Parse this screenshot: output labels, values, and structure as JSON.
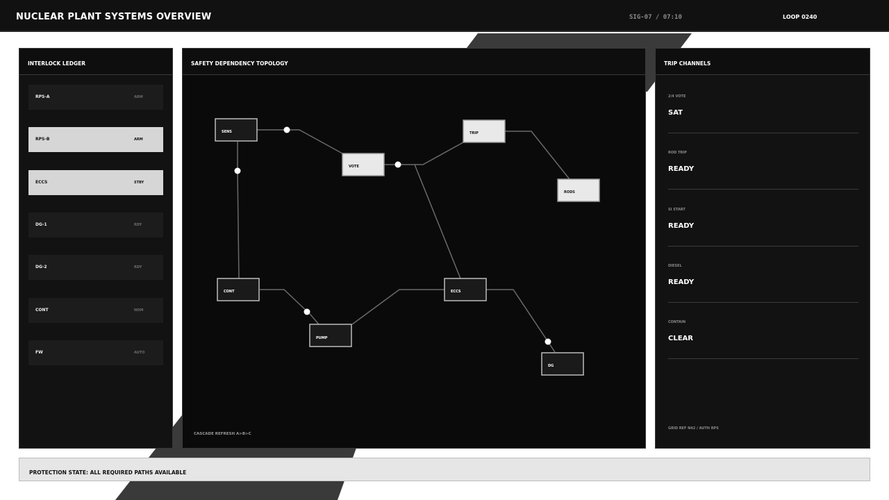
{
  "header": {
    "title": "NUCLEAR PLANT SYSTEMS OVERVIEW",
    "signal": "SIG-07 / 07:10",
    "loop": "LOOP 0240"
  },
  "ledger": {
    "title": "INTERLOCK LEDGER",
    "items": [
      {
        "name": "RPS-A",
        "state": "ARM",
        "active": false
      },
      {
        "name": "RPS-B",
        "state": "ARM",
        "active": true
      },
      {
        "name": "ECCS",
        "state": "STBY",
        "active": true
      },
      {
        "name": "DG-1",
        "state": "RDY",
        "active": false
      },
      {
        "name": "DG-2",
        "state": "RDY",
        "active": false
      },
      {
        "name": "CONT",
        "state": "NOM",
        "active": false
      },
      {
        "name": "FW",
        "state": "AUTO",
        "active": false
      }
    ]
  },
  "topology": {
    "title": "SAFETY DEPENDENCY TOPOLOGY",
    "nodes": {
      "sens": "SENS",
      "vote": "VOTE",
      "trip": "TRIP",
      "rods": "RODS",
      "cont": "CONT",
      "pump": "PUMP",
      "eccs": "ECCS",
      "dg": "DG"
    },
    "footer": "CASCADE REFRESH  A>B>C"
  },
  "trip_channels": {
    "title": "TRIP CHANNELS",
    "rows": [
      {
        "label": "2/4 VOTE",
        "value": "SAT"
      },
      {
        "label": "ROD TRIP",
        "value": "READY"
      },
      {
        "label": "SI START",
        "value": "READY"
      },
      {
        "label": "DIESEL",
        "value": "READY"
      },
      {
        "label": "CONTAIN",
        "value": "CLEAR"
      }
    ],
    "footer": "GRID REF N42 / AUTH RPS"
  },
  "status": {
    "text": "PROTECTION STATE: ALL REQUIRED PATHS AVAILABLE"
  },
  "colors": {
    "background": "#111111",
    "panel": "#121212",
    "highlight": "#d6d6d6",
    "status_bar": "#e6e6e6"
  }
}
